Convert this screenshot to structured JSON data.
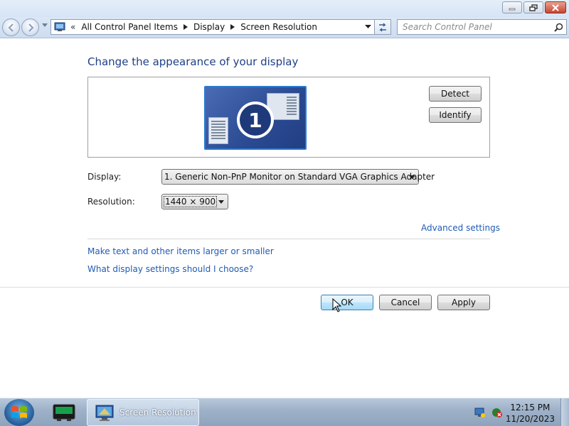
{
  "window": {
    "buttons": {
      "minimize": "minimize",
      "restore": "restore",
      "close": "close"
    }
  },
  "navbar": {
    "address_chevron": "«",
    "breadcrumbs": [
      "All Control Panel Items",
      "Display",
      "Screen Resolution"
    ],
    "search_placeholder": "Search Control Panel"
  },
  "content": {
    "heading": "Change the appearance of your display",
    "monitor_number": "1",
    "detect_label": "Detect",
    "identify_label": "Identify",
    "display_label": "Display:",
    "display_value": "1. Generic Non-PnP Monitor on Standard VGA Graphics Adapter",
    "resolution_label": "Resolution:",
    "resolution_value": "1440 × 900",
    "advanced_link": "Advanced settings",
    "larger_link": "Make text and other items larger or smaller",
    "which_link": "What display settings should I choose?"
  },
  "footer": {
    "ok_label": "OK",
    "cancel_label": "Cancel",
    "apply_label": "Apply"
  },
  "taskbar": {
    "task_title": "Screen Resolution",
    "time": "12:15 PM",
    "date": "11/20/2023"
  },
  "colors": {
    "heading": "#1e3f87",
    "link": "#1f5bb5",
    "monitor_border": "#2a7bd0"
  }
}
